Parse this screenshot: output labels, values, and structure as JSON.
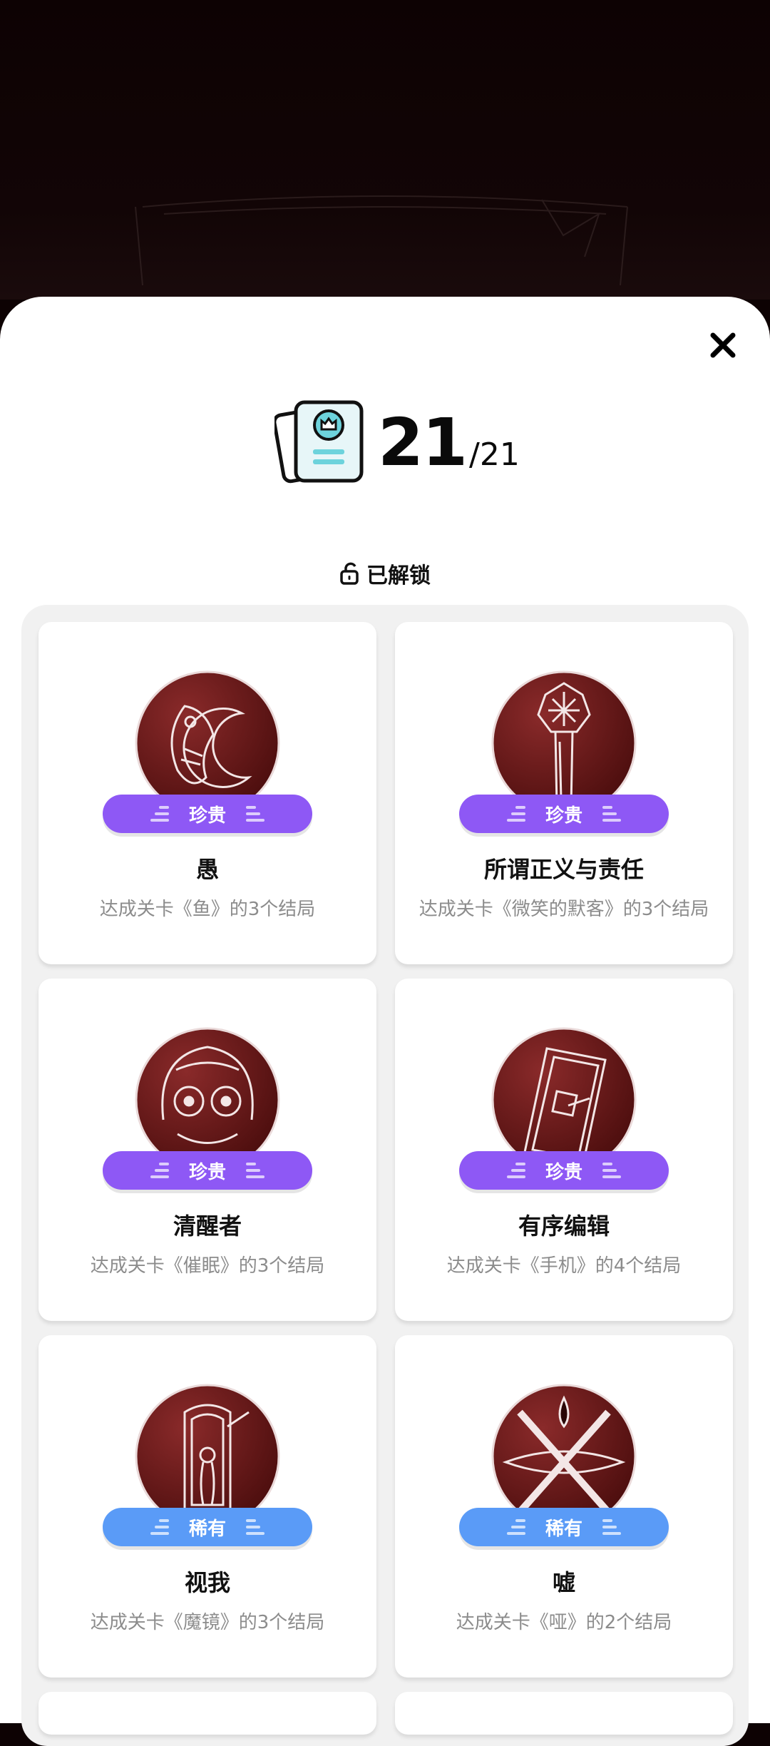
{
  "header": {
    "unlocked_count": "21",
    "total": "/21",
    "unlocked_label": "已解锁"
  },
  "colors": {
    "precious": "#8e58f5",
    "rare": "#5a9bf7",
    "medal": "#6e1b1b"
  },
  "achievements": [
    {
      "title": "愚",
      "desc": "达成关卡《鱼》的3个结局",
      "rarity": "珍贵",
      "icon": "fish-medal-icon"
    },
    {
      "title": "所谓正义与责任",
      "desc": "达成关卡《微笑的默客》的3个结局",
      "rarity": "珍贵",
      "icon": "sword-medal-icon"
    },
    {
      "title": "清醒者",
      "desc": "达成关卡《催眠》的3个结局",
      "rarity": "珍贵",
      "icon": "face-medal-icon"
    },
    {
      "title": "有序编辑",
      "desc": "达成关卡《手机》的4个结局",
      "rarity": "珍贵",
      "icon": "phone-medal-icon"
    },
    {
      "title": "视我",
      "desc": "达成关卡《魔镜》的3个结局",
      "rarity": "稀有",
      "icon": "mirror-medal-icon"
    },
    {
      "title": "嘘",
      "desc": "达成关卡《哑》的2个结局",
      "rarity": "稀有",
      "icon": "mouth-medal-icon"
    }
  ]
}
